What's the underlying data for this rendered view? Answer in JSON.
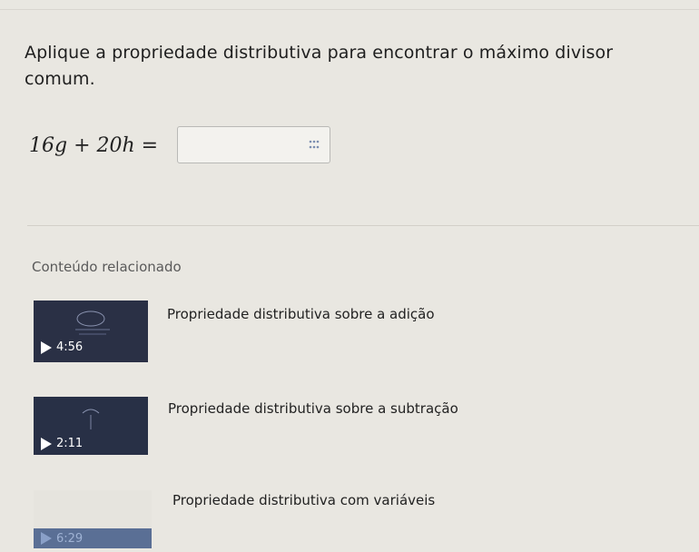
{
  "question": {
    "text": "Aplique a propriedade distributiva para encontrar o máximo divisor comum."
  },
  "equation": {
    "expression": "16g + 20h =",
    "answer_value": "",
    "keypad_icon": "math-keypad-icon"
  },
  "related": {
    "heading": "Conteúdo relacionado",
    "videos": [
      {
        "title": "Propriedade distributiva sobre a adição",
        "duration": "4:56"
      },
      {
        "title": "Propriedade distributiva sobre a subtração",
        "duration": "2:11"
      },
      {
        "title": "Propriedade distributiva com variáveis",
        "duration": "6:29"
      }
    ]
  },
  "colors": {
    "background": "#e9e7e1",
    "thumbnail_dark": "#2a3045",
    "duration_bar_blue": "#5a6f95"
  }
}
